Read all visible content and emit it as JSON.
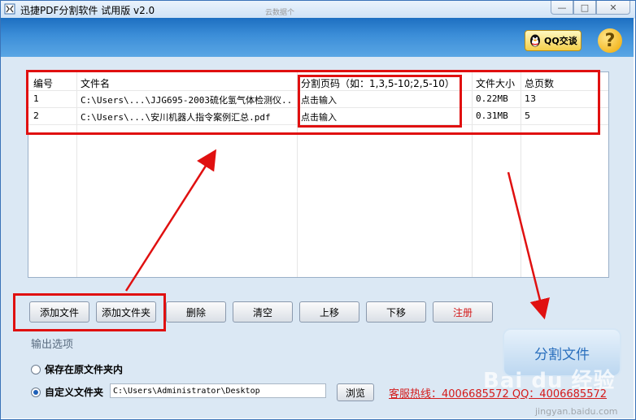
{
  "window": {
    "title": "迅捷PDF分割软件 试用版 v2.0",
    "ghost_title": "云数据个",
    "controls": {
      "minimize": "—",
      "maximize": "□",
      "close": "✕"
    }
  },
  "header": {
    "qq_label": "QQ交谈",
    "help_label": "?"
  },
  "table": {
    "columns": [
      "编号",
      "文件名",
      "分割页码（如：1,3,5-10;2,5-10）",
      "文件大小",
      "总页数"
    ],
    "rows": [
      {
        "id": "1",
        "filename": "C:\\Users\\...\\JJG695-2003硫化氢气体检测仪...",
        "pages_input": "点击输入",
        "size": "0.22MB",
        "total": "13"
      },
      {
        "id": "2",
        "filename": "C:\\Users\\...\\安川机器人指令案例汇总.pdf",
        "pages_input": "点击输入",
        "size": "0.31MB",
        "total": "5"
      }
    ]
  },
  "toolbar": {
    "add_file": "添加文件",
    "add_folder": "添加文件夹",
    "delete": "删除",
    "clear": "清空",
    "move_up": "上移",
    "move_down": "下移",
    "register": "注册"
  },
  "output": {
    "section_title": "输出选项",
    "option_original": "保存在原文件夹内",
    "option_custom": "自定义文件夹",
    "path_value": "C:\\Users\\Administrator\\Desktop",
    "browse": "浏览",
    "hotline": "客服热线：4006685572 QQ：4006685572"
  },
  "split_button": "分割文件",
  "watermark": {
    "logo": "Bai du 经验",
    "url": "jingyan.baidu.com"
  },
  "colors": {
    "header_blue": "#1d6fc1",
    "annotation_red": "#e01010",
    "register_red": "#d41a1a",
    "accent_blue": "#2a6fbd"
  }
}
